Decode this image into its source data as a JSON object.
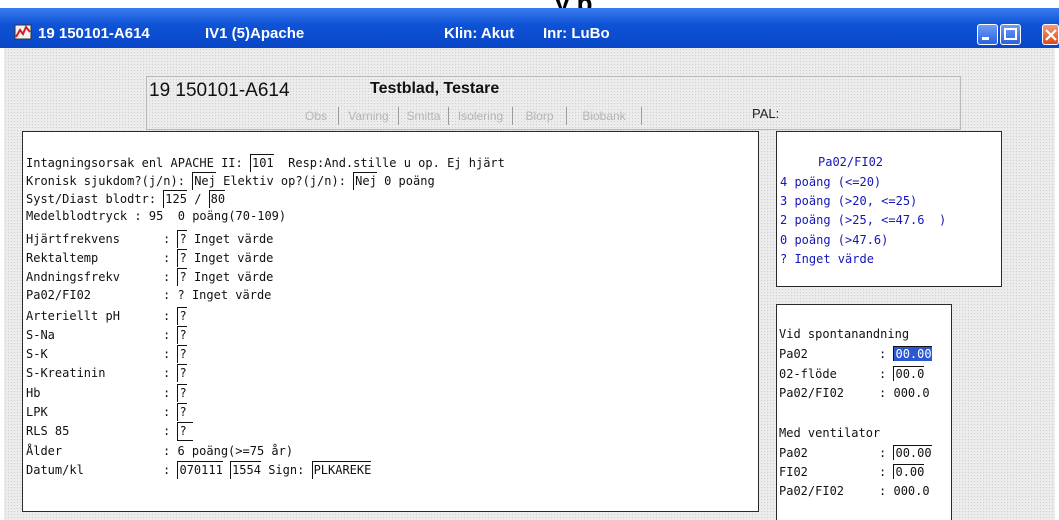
{
  "top_fragment": "y  p",
  "window": {
    "title_patient": "19 150101-A614",
    "title_module": "IV1 (5)Apache",
    "title_klin": "Klin: Akut",
    "title_inr": "Inr: LuBo"
  },
  "header": {
    "patient_id": "19 150101-A614",
    "patient_name": "Testblad, Testare",
    "tags": [
      "Obs",
      "Varning",
      "Smitta",
      "Isolering",
      "Blorp",
      "Biobank"
    ],
    "pal_label": "PAL:"
  },
  "form": {
    "intake_label": "Intagningsorsak enl APACHE II:",
    "intake_code": "101",
    "intake_desc": "Resp:And.stille u op. Ej hjärt",
    "chronic_label": "Kronisk sjukdom?(j/n):",
    "chronic_value": "Nej",
    "elective_label": "Elektiv op?(j/n):",
    "elective_value": "Nej",
    "elective_points": "0 poäng",
    "bp_label": "Syst/Diast blodtr:",
    "bp_syst": "125",
    "bp_sep": "/",
    "bp_diast": "80",
    "map_label": "Medelblodtryck",
    "map_colon": ":",
    "map_value": "95  0 poäng(70-109)",
    "hr_label": "Hjärtfrekvens",
    "hr_value": "?",
    "hr_desc": "Inget värde",
    "temp_label": "Rektaltemp",
    "temp_value": "?",
    "temp_desc": "Inget värde",
    "rr_label": "Andningsfrekv",
    "rr_value": "?",
    "rr_desc": "Inget värde",
    "pafi_label": "Pa02/FI02",
    "pafi_value": "?",
    "pafi_desc": "Inget värde",
    "ph_label": "Arteriellt pH",
    "ph_value": "?",
    "na_label": "S-Na",
    "na_value": "?",
    "k_label": "S-K",
    "k_value": "?",
    "krea_label": "S-Kreatinin",
    "krea_value": "?",
    "hb_label": "Hb",
    "hb_value": "?",
    "lpk_label": "LPK",
    "lpk_value": "?",
    "rls_label": "RLS 85",
    "rls_value": "?",
    "age_label": "Ålder",
    "age_value": "6 poäng(>=75 år)",
    "date_label": "Datum/kl",
    "date_value": "070111",
    "time_value": "1554",
    "sign_label": "Sign:",
    "sign_value": "PLKAREKE"
  },
  "score_panel": {
    "title": "Pa02/FI02",
    "rows": [
      "4 poäng (<=20)",
      "3 poäng (>20, <=25)",
      "2 poäng (>25, <=47.6  )",
      "0 poäng (>47.6)",
      "? Inget värde"
    ]
  },
  "calc_panel": {
    "spont_title": "Vid spontanandning",
    "spont_pa02_label": "Pa02",
    "spont_pa02_value": "00.00",
    "spont_flow_label": "02-flöde",
    "spont_flow_value": "00.0",
    "spont_ratio_label": "Pa02/FI02",
    "spont_ratio_value": "000.0",
    "vent_title": "Med ventilator",
    "vent_pa02_label": "Pa02",
    "vent_pa02_value": "00.00",
    "vent_fio2_label": "FI02",
    "vent_fio2_value": "0.00",
    "vent_ratio_label": "Pa02/FI02",
    "vent_ratio_value": "000.0",
    "colon": ":"
  }
}
